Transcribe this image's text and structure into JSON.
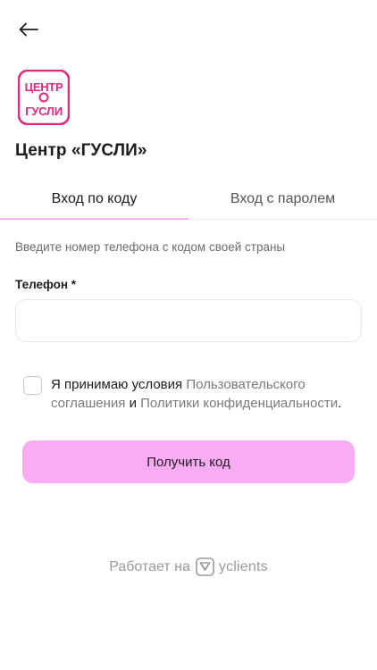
{
  "header": {
    "back_icon": "arrow-left-icon"
  },
  "company": {
    "logo_text_top": "ЦЕНТР",
    "logo_text_bottom": "ГУСЛИ",
    "name": "Центр «ГУСЛИ»",
    "brand_color": "#e0287f"
  },
  "tabs": [
    {
      "label": "Вход по коду",
      "active": true
    },
    {
      "label": "Вход с паролем",
      "active": false
    }
  ],
  "form": {
    "hint": "Введите номер телефона с кодом своей страны",
    "phone_label": "Телефон *",
    "phone_value": "",
    "phone_placeholder": "",
    "agreement": {
      "checked": false,
      "prefix": "Я принимаю условия ",
      "link1": "Пользовательского соглашения",
      "middle": " и ",
      "link2": "Политики конфиденциальности",
      "suffix": "."
    },
    "submit_label": "Получить код",
    "submit_color": "#f9abf3"
  },
  "footer": {
    "prefix": "Работает на",
    "brand": "yclients",
    "brand_icon": "yclients-logo-icon"
  },
  "colors": {
    "tab_indicator": "#f6b3ef",
    "link": "#7a7a7a"
  }
}
